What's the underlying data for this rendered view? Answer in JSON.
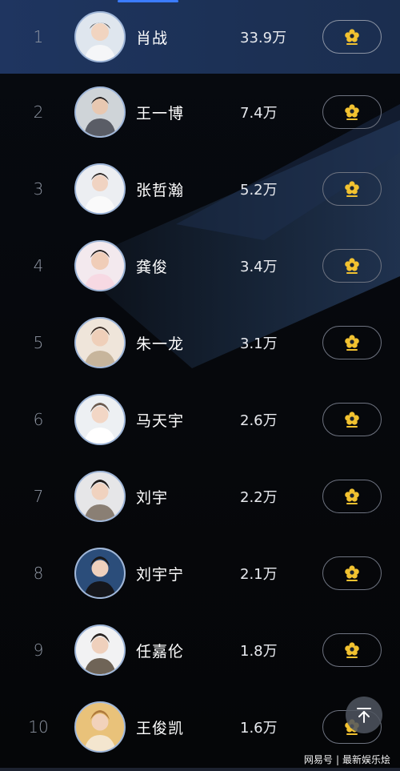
{
  "ranking": [
    {
      "rank": "1",
      "name": "肖战",
      "count": "33.9万"
    },
    {
      "rank": "2",
      "name": "王一博",
      "count": "7.4万"
    },
    {
      "rank": "3",
      "name": "张哲瀚",
      "count": "5.2万"
    },
    {
      "rank": "4",
      "name": "龚俊",
      "count": "3.4万"
    },
    {
      "rank": "5",
      "name": "朱一龙",
      "count": "3.1万"
    },
    {
      "rank": "6",
      "name": "马天宇",
      "count": "2.6万"
    },
    {
      "rank": "7",
      "name": "刘宇",
      "count": "2.2万"
    },
    {
      "rank": "8",
      "name": "刘宇宁",
      "count": "2.1万"
    },
    {
      "rank": "9",
      "name": "任嘉伦",
      "count": "1.8万"
    },
    {
      "rank": "10",
      "name": "王俊凯",
      "count": "1.6万"
    }
  ],
  "icons": {
    "vote": "flower-icon",
    "scroll_top": "arrow-up-to-top-icon"
  },
  "colors": {
    "accent": "#3b7cff",
    "highlight_row": "#1f3560",
    "flower": "#f2c230",
    "text_primary": "#ffffff",
    "text_rank": "#8f96a3"
  },
  "watermark": {
    "brand": "网易号",
    "separator": "|",
    "account": "最新娱乐烩"
  }
}
